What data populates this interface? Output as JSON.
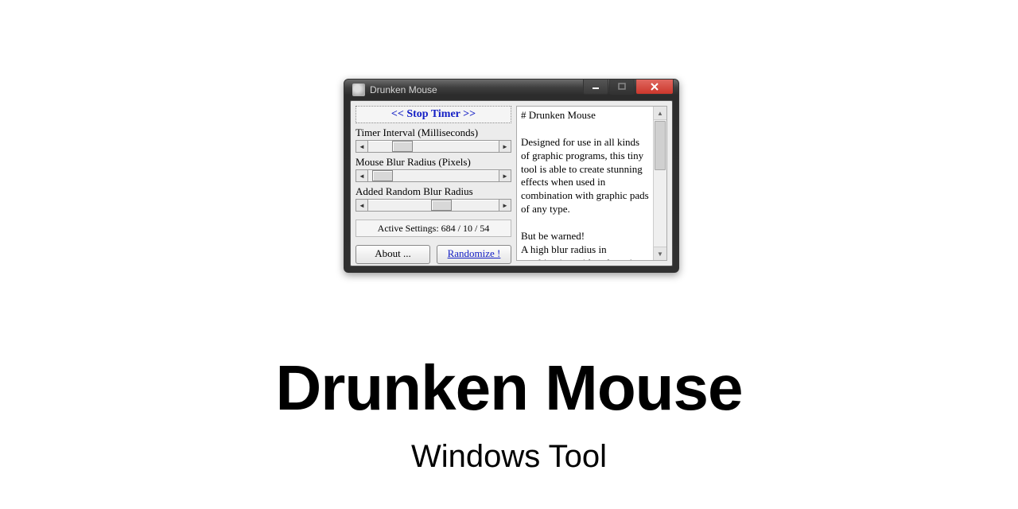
{
  "window": {
    "title": "Drunken Mouse",
    "controls": {
      "minimize_icon": "minimize-icon",
      "maximize_icon": "maximize-icon",
      "close_icon": "close-icon"
    }
  },
  "left": {
    "stop_timer_label": "<<  Stop Timer  >>",
    "sliders": [
      {
        "label": "Timer Interval (Milliseconds)",
        "thumb_left_pct": 18
      },
      {
        "label": "Mouse Blur Radius (Pixels)",
        "thumb_left_pct": 3
      },
      {
        "label": "Added Random Blur Radius",
        "thumb_left_pct": 48
      }
    ],
    "active_settings": "Active Settings: 684 / 10 / 54",
    "about_label": "About ...",
    "randomize_label": "Randomize !"
  },
  "right": {
    "heading": "# Drunken Mouse",
    "body": "Designed for use in all kinds of graphic programs, this tiny tool is able to create stunning effects when used in combination with graphic pads of any type.\n\nBut be warned!\nA high blur radius in combination with a short timer"
  },
  "page": {
    "headline": "Drunken Mouse",
    "subhead": "Windows Tool"
  }
}
